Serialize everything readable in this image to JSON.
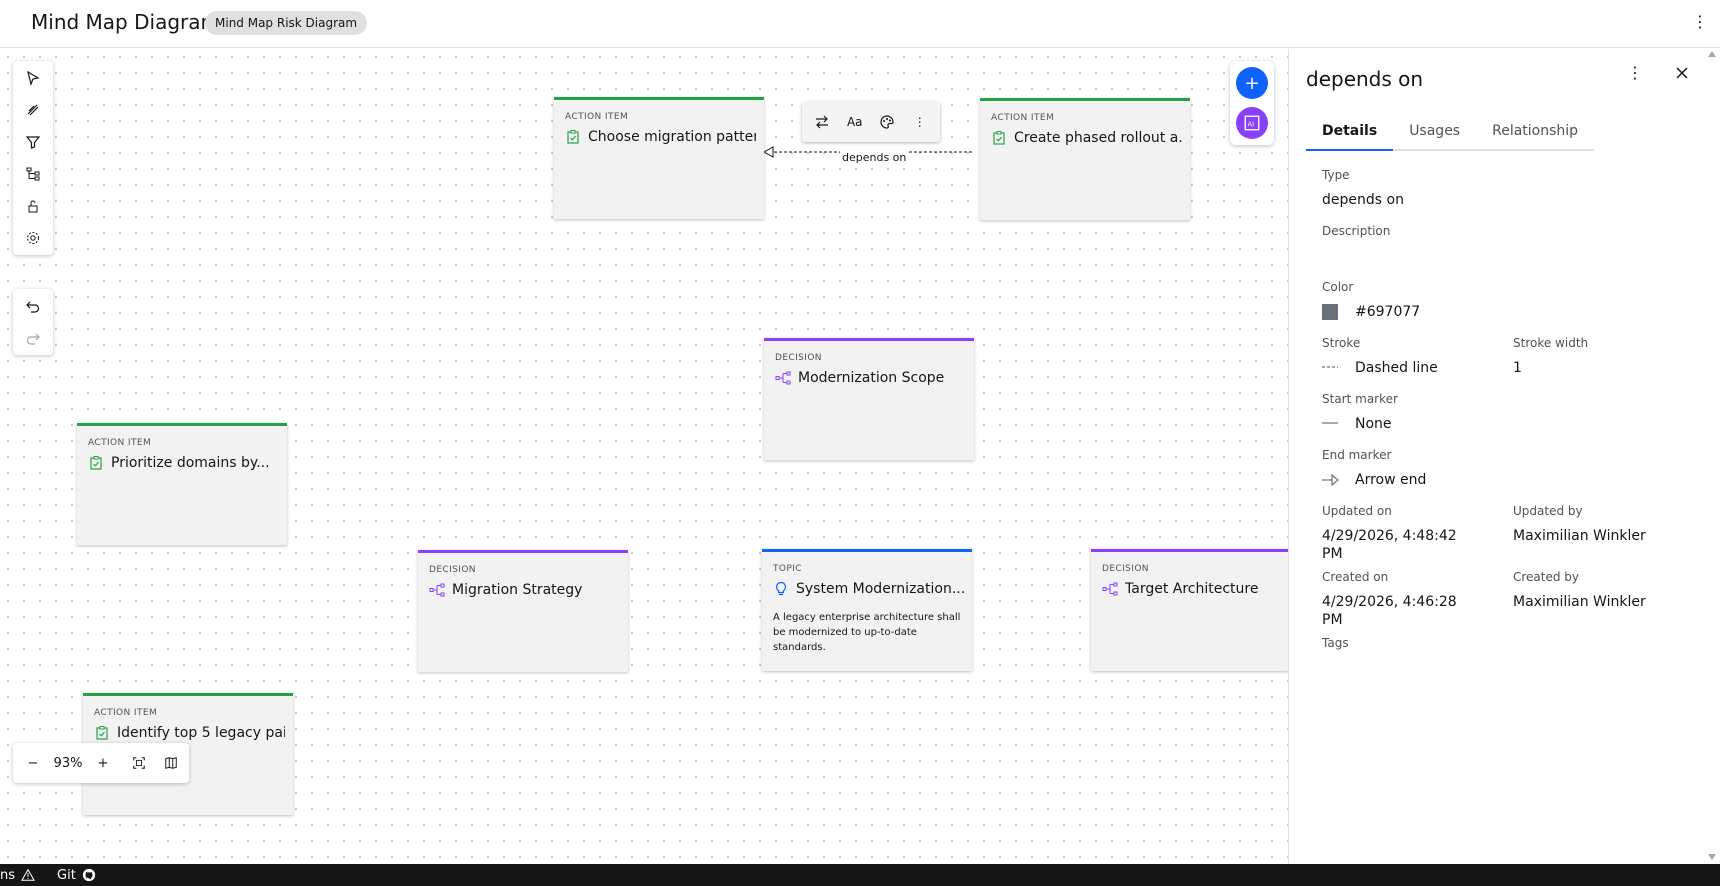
{
  "header": {
    "title": "Mind Map Diagram",
    "badge": "Mind Map Risk Diagram",
    "menu_icon": "overflow-menu-vertical-icon"
  },
  "left_toolbar": {
    "tools": [
      "select-pointer-icon",
      "draw-connector-icon",
      "filter-icon",
      "hierarchy-layout-icon",
      "unlock-icon",
      "settings-icon"
    ],
    "history": [
      "undo-icon",
      "redo-icon"
    ]
  },
  "canvas": {
    "cards": [
      {
        "kind": "action",
        "type_label": "ACTION ITEM",
        "title": "Choose migration patter..."
      },
      {
        "kind": "action",
        "type_label": "ACTION ITEM",
        "title": "Create phased rollout a..."
      },
      {
        "kind": "decision",
        "type_label": "DECISION",
        "title": "Modernization Scope"
      },
      {
        "kind": "action",
        "type_label": "ACTION ITEM",
        "title": "Prioritize domains by..."
      },
      {
        "kind": "decision",
        "type_label": "DECISION",
        "title": "Migration Strategy"
      },
      {
        "kind": "topic",
        "type_label": "TOPIC",
        "title": "System Modernization...",
        "description": "A legacy enterprise architecture shall be modernized to up-to-date standards."
      },
      {
        "kind": "decision",
        "type_label": "DECISION",
        "title": "Target Architecture"
      },
      {
        "kind": "action",
        "type_label": "ACTION ITEM",
        "title": "Identify top 5 legacy pai..."
      }
    ],
    "edge": {
      "label": "depends on",
      "color": "#697077"
    },
    "edge_toolbar": {
      "swap_icon": "swap-direction-icon",
      "text_label": "Aa",
      "palette_icon": "color-palette-icon",
      "more_icon": "overflow-menu-vertical-icon"
    },
    "fab": {
      "add_icon": "add-icon",
      "ai_label": "AI"
    },
    "zoom": {
      "minus": "−",
      "level": "93%",
      "plus": "+",
      "fit_icon": "fit-to-screen-icon",
      "minimap_icon": "minimap-icon"
    }
  },
  "panel": {
    "title": "depends on",
    "tabs": [
      "Details",
      "Usages",
      "Relationship"
    ],
    "active_tab": "Details",
    "fields": {
      "type_label": "Type",
      "type_value": "depends on",
      "description_label": "Description",
      "description_value": "",
      "color_label": "Color",
      "color_value": "#697077",
      "stroke_label": "Stroke",
      "stroke_value": "Dashed line",
      "stroke_width_label": "Stroke width",
      "stroke_width_value": "1",
      "start_marker_label": "Start marker",
      "start_marker_value": "None",
      "end_marker_label": "End marker",
      "end_marker_value": "Arrow end",
      "updated_on_label": "Updated on",
      "updated_on_value": "4/29/2026, 4:48:42 PM",
      "updated_by_label": "Updated by",
      "updated_by_value": "Maximilian Winkler",
      "created_on_label": "Created on",
      "created_on_value": "4/29/2026, 4:46:28 PM",
      "created_by_label": "Created by",
      "created_by_value": "Maximilian Winkler",
      "tags_label": "Tags"
    }
  },
  "statusbar": {
    "left_text": "ns",
    "warning_icon": "warning-icon",
    "git_label": "Git",
    "github_icon": "github-icon"
  },
  "colors": {
    "action": "#24a148",
    "decision": "#8a3ffc",
    "topic": "#0f62fe",
    "fab_add": "#0f62fe",
    "fab_ai": "#8a3ffc",
    "edge": "#697077"
  }
}
